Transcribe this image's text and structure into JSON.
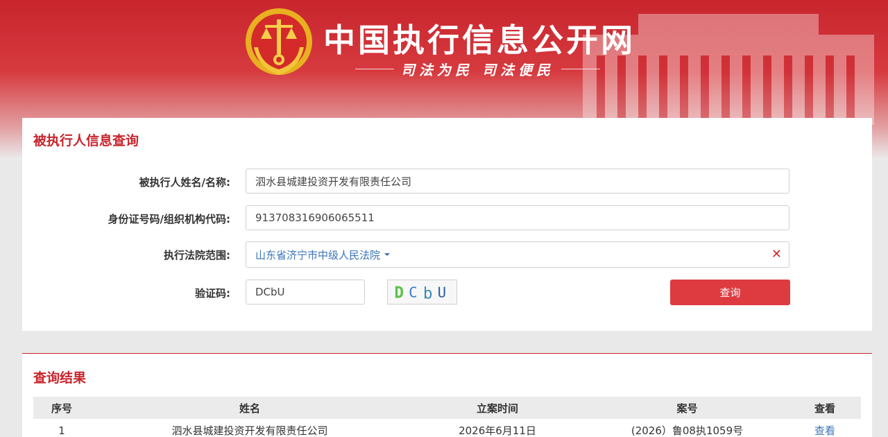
{
  "header": {
    "site_title": "中国执行信息公开网",
    "slogan": "司法为民  司法便民"
  },
  "search_card": {
    "title": "被执行人信息查询",
    "fields": {
      "name_label": "被执行人姓名/名称:",
      "name_value": "泗水县城建投资开发有限责任公司",
      "id_label": "身份证号码/组织机构代码:",
      "id_value": "91370831690606551​1",
      "court_label": "执行法院范围:",
      "court_value": "山东省济宁市中级人民法院",
      "captcha_label": "验证码:",
      "captcha_value": "DCbU",
      "captcha_image_text": "DCbU"
    },
    "query_button": "查询"
  },
  "results_card": {
    "title": "查询结果",
    "columns": [
      "序号",
      "姓名",
      "立案时间",
      "案号",
      "查看"
    ],
    "rows": [
      {
        "index": "1",
        "name": "泗水县城建投资开发有限责任公司",
        "filing_date": "2026年6月11日",
        "case_no": "(2026）鲁08执1059号",
        "view": "查看"
      }
    ]
  },
  "icons": {
    "clear": "close-icon",
    "dropdown": "caret-down-icon",
    "emblem": "court-emblem-icon"
  },
  "colors": {
    "brand_red": "#c8252d",
    "button_red": "#de3b40",
    "link_blue": "#3a73b8"
  }
}
